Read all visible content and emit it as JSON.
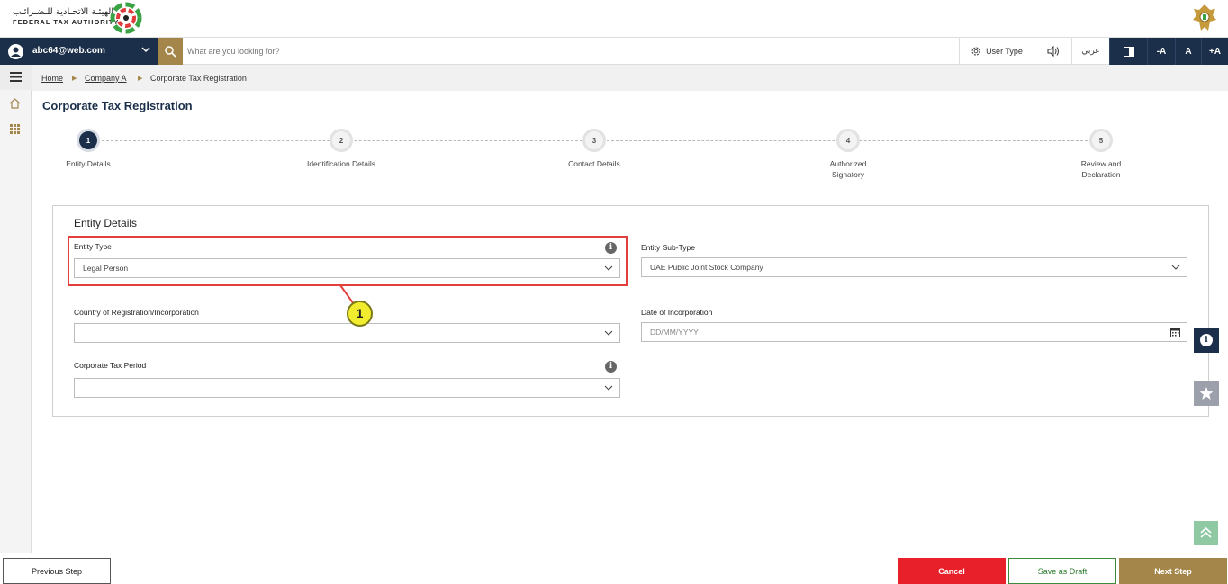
{
  "header": {
    "logo_ar": "الهيئـة الاتحـادية للـضـرائـب",
    "logo_en": "FEDERAL TAX AUTHORITY"
  },
  "topbar": {
    "user_email": "abc64@web.com",
    "search_placeholder": "What are you looking for?",
    "user_type_label": "User Type",
    "arabic_label": "عربي",
    "font_decrease": "-A",
    "font_normal": "A",
    "font_increase": "+A"
  },
  "breadcrumb": {
    "home": "Home",
    "company": "Company A",
    "current": "Corporate Tax Registration"
  },
  "page_title": "Corporate Tax Registration",
  "steps": [
    {
      "num": "1",
      "label": "Entity Details",
      "active": true
    },
    {
      "num": "2",
      "label": "Identification Details",
      "active": false
    },
    {
      "num": "3",
      "label": "Contact Details",
      "active": false
    },
    {
      "num": "4",
      "label": "Authorized Signatory",
      "active": false
    },
    {
      "num": "5",
      "label": "Review and Declaration",
      "active": false
    }
  ],
  "form": {
    "title": "Entity Details",
    "entity_type_label": "Entity Type",
    "entity_type_value": "Legal Person",
    "entity_subtype_label": "Entity Sub-Type",
    "entity_subtype_value": "UAE Public Joint Stock Company",
    "country_label": "Country of Registration/Incorporation",
    "country_value": "",
    "date_label": "Date of Incorporation",
    "date_placeholder": "DD/MM/YYYY",
    "tax_period_label": "Corporate Tax Period",
    "tax_period_value": ""
  },
  "callout": "1",
  "footer": {
    "previous": "Previous Step",
    "cancel": "Cancel",
    "save_draft": "Save as Draft",
    "next": "Next Step"
  },
  "colors": {
    "navy": "#1b2f4a",
    "gold": "#a5864a",
    "cancel_red": "#e8202a",
    "highlight_red": "#e2403c",
    "callout_yellow": "#f2ec2f"
  }
}
